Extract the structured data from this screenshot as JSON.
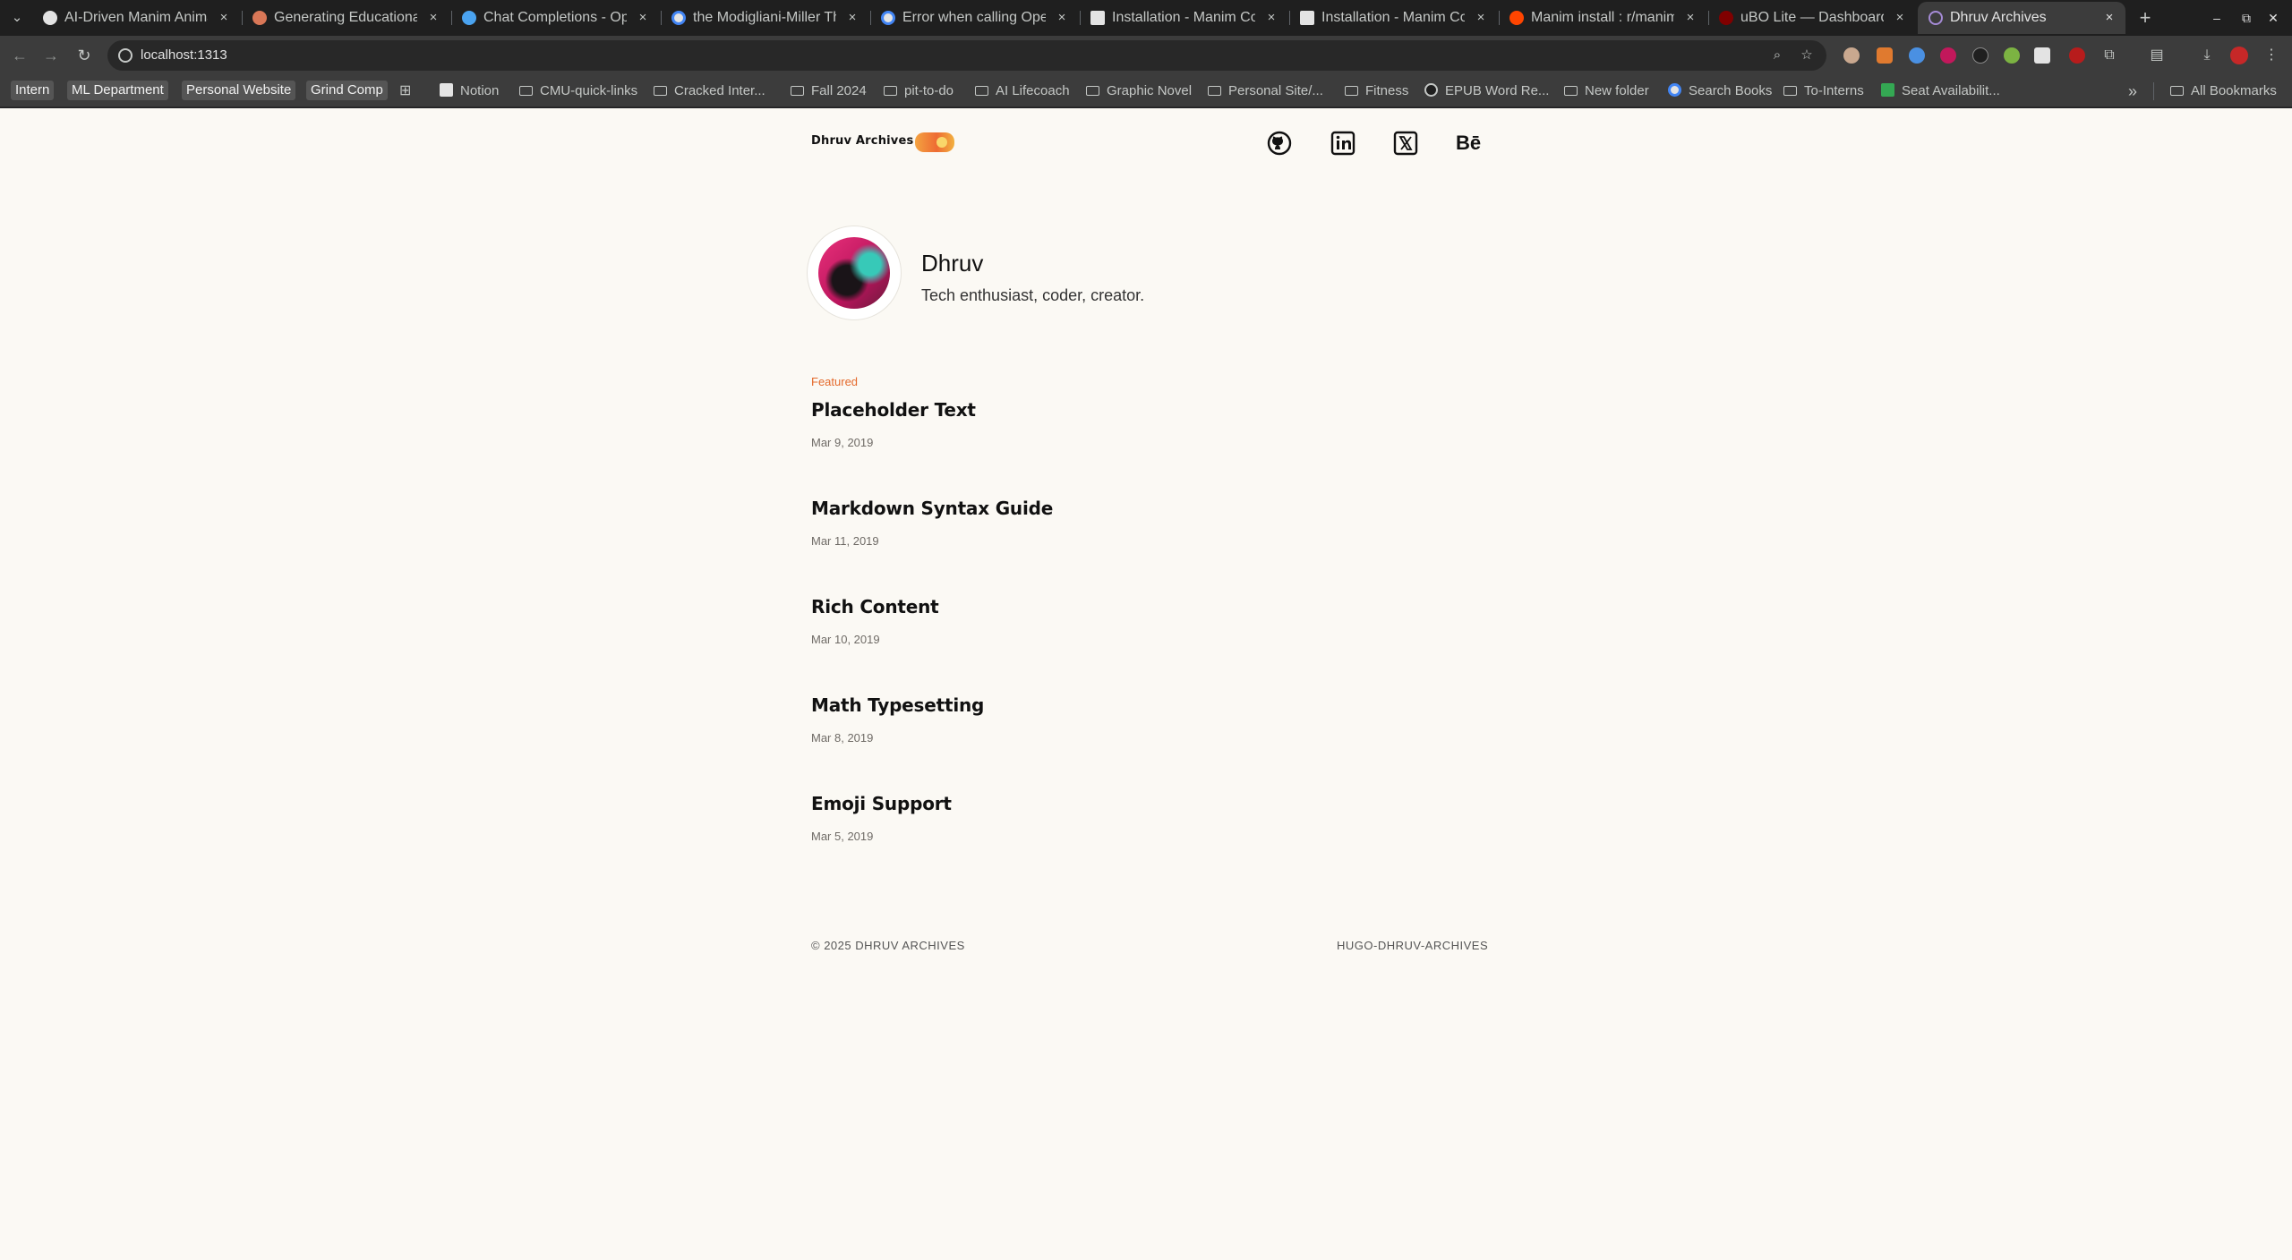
{
  "tabs": [
    {
      "title": "AI-Driven Manim Animat",
      "favicon": "github-icon"
    },
    {
      "title": "Generating Educational",
      "favicon": "claude-icon"
    },
    {
      "title": "Chat Completions - Ope",
      "favicon": "openai-icon"
    },
    {
      "title": "the Modigliani-Miller Th",
      "favicon": "google-icon"
    },
    {
      "title": "Error when calling Open",
      "favicon": "google-icon"
    },
    {
      "title": "Installation - Manim Cor",
      "favicon": "manim-icon"
    },
    {
      "title": "Installation - Manim Co",
      "favicon": "manim-icon"
    },
    {
      "title": "Manim install : r/manim",
      "favicon": "reddit-icon"
    },
    {
      "title": "uBO Lite — Dashboard",
      "favicon": "ublock-icon"
    },
    {
      "title": "Dhruv Archives",
      "favicon": "site-icon",
      "active": true
    }
  ],
  "tab_close_glyph": "×",
  "new_tab_glyph": "+",
  "window_controls": {
    "minimize": "–",
    "maximize": "⧉",
    "close": "✕"
  },
  "toolbar": {
    "back_glyph": "←",
    "forward_glyph": "→",
    "reload_glyph": "↻",
    "url": "localhost:1313",
    "zoom_glyph": "⌕",
    "star_glyph": "☆"
  },
  "bookmarks": [
    {
      "label": "Intern",
      "style": "pill"
    },
    {
      "label": "ML Department",
      "style": "pill"
    },
    {
      "label": "Personal Website",
      "style": "pill"
    },
    {
      "label": "Grind Comp",
      "style": "pill"
    },
    {
      "label": "Notion",
      "style": "icon"
    },
    {
      "label": "CMU-quick-links",
      "style": "folder"
    },
    {
      "label": "Cracked Inter...",
      "style": "folder"
    },
    {
      "label": "Fall 2024",
      "style": "folder"
    },
    {
      "label": "pit-to-do",
      "style": "folder"
    },
    {
      "label": "AI Lifecoach",
      "style": "folder"
    },
    {
      "label": "Graphic Novel",
      "style": "folder"
    },
    {
      "label": "Personal Site/...",
      "style": "folder"
    },
    {
      "label": "Fitness",
      "style": "folder"
    },
    {
      "label": "EPUB Word Re...",
      "style": "icon"
    },
    {
      "label": "New folder",
      "style": "folder"
    },
    {
      "label": "Search Books",
      "style": "icon"
    },
    {
      "label": "To-Interns",
      "style": "folder"
    },
    {
      "label": "Seat Availabilit...",
      "style": "icon"
    }
  ],
  "bookmarks_overflow": "»",
  "all_bookmarks": "All Bookmarks",
  "site": {
    "title": "Dhruv Archives",
    "social": [
      {
        "name": "github-icon"
      },
      {
        "name": "linkedin-icon"
      },
      {
        "name": "x-icon"
      },
      {
        "name": "behance-icon",
        "text": "Bē"
      }
    ]
  },
  "profile": {
    "name": "Dhruv",
    "bio": "Tech enthusiast, coder, creator."
  },
  "featured_label": "Featured",
  "posts": [
    {
      "title": "Placeholder Text",
      "date": "Mar 9, 2019"
    },
    {
      "title": "Markdown Syntax Guide",
      "date": "Mar 11, 2019"
    },
    {
      "title": "Rich Content",
      "date": "Mar 10, 2019"
    },
    {
      "title": "Math Typesetting",
      "date": "Mar 8, 2019"
    },
    {
      "title": "Emoji Support",
      "date": "Mar 5, 2019"
    }
  ],
  "footer": {
    "copyright": "© 2025 DHRUV ARCHIVES",
    "theme": "HUGO-DHRUV-ARCHIVES"
  },
  "colors": {
    "page_bg": "#fbf9f4",
    "featured_accent": "#e46a2c",
    "chrome_dark": "#1f1f1f",
    "chrome_toolbar": "#3c3c3c"
  }
}
